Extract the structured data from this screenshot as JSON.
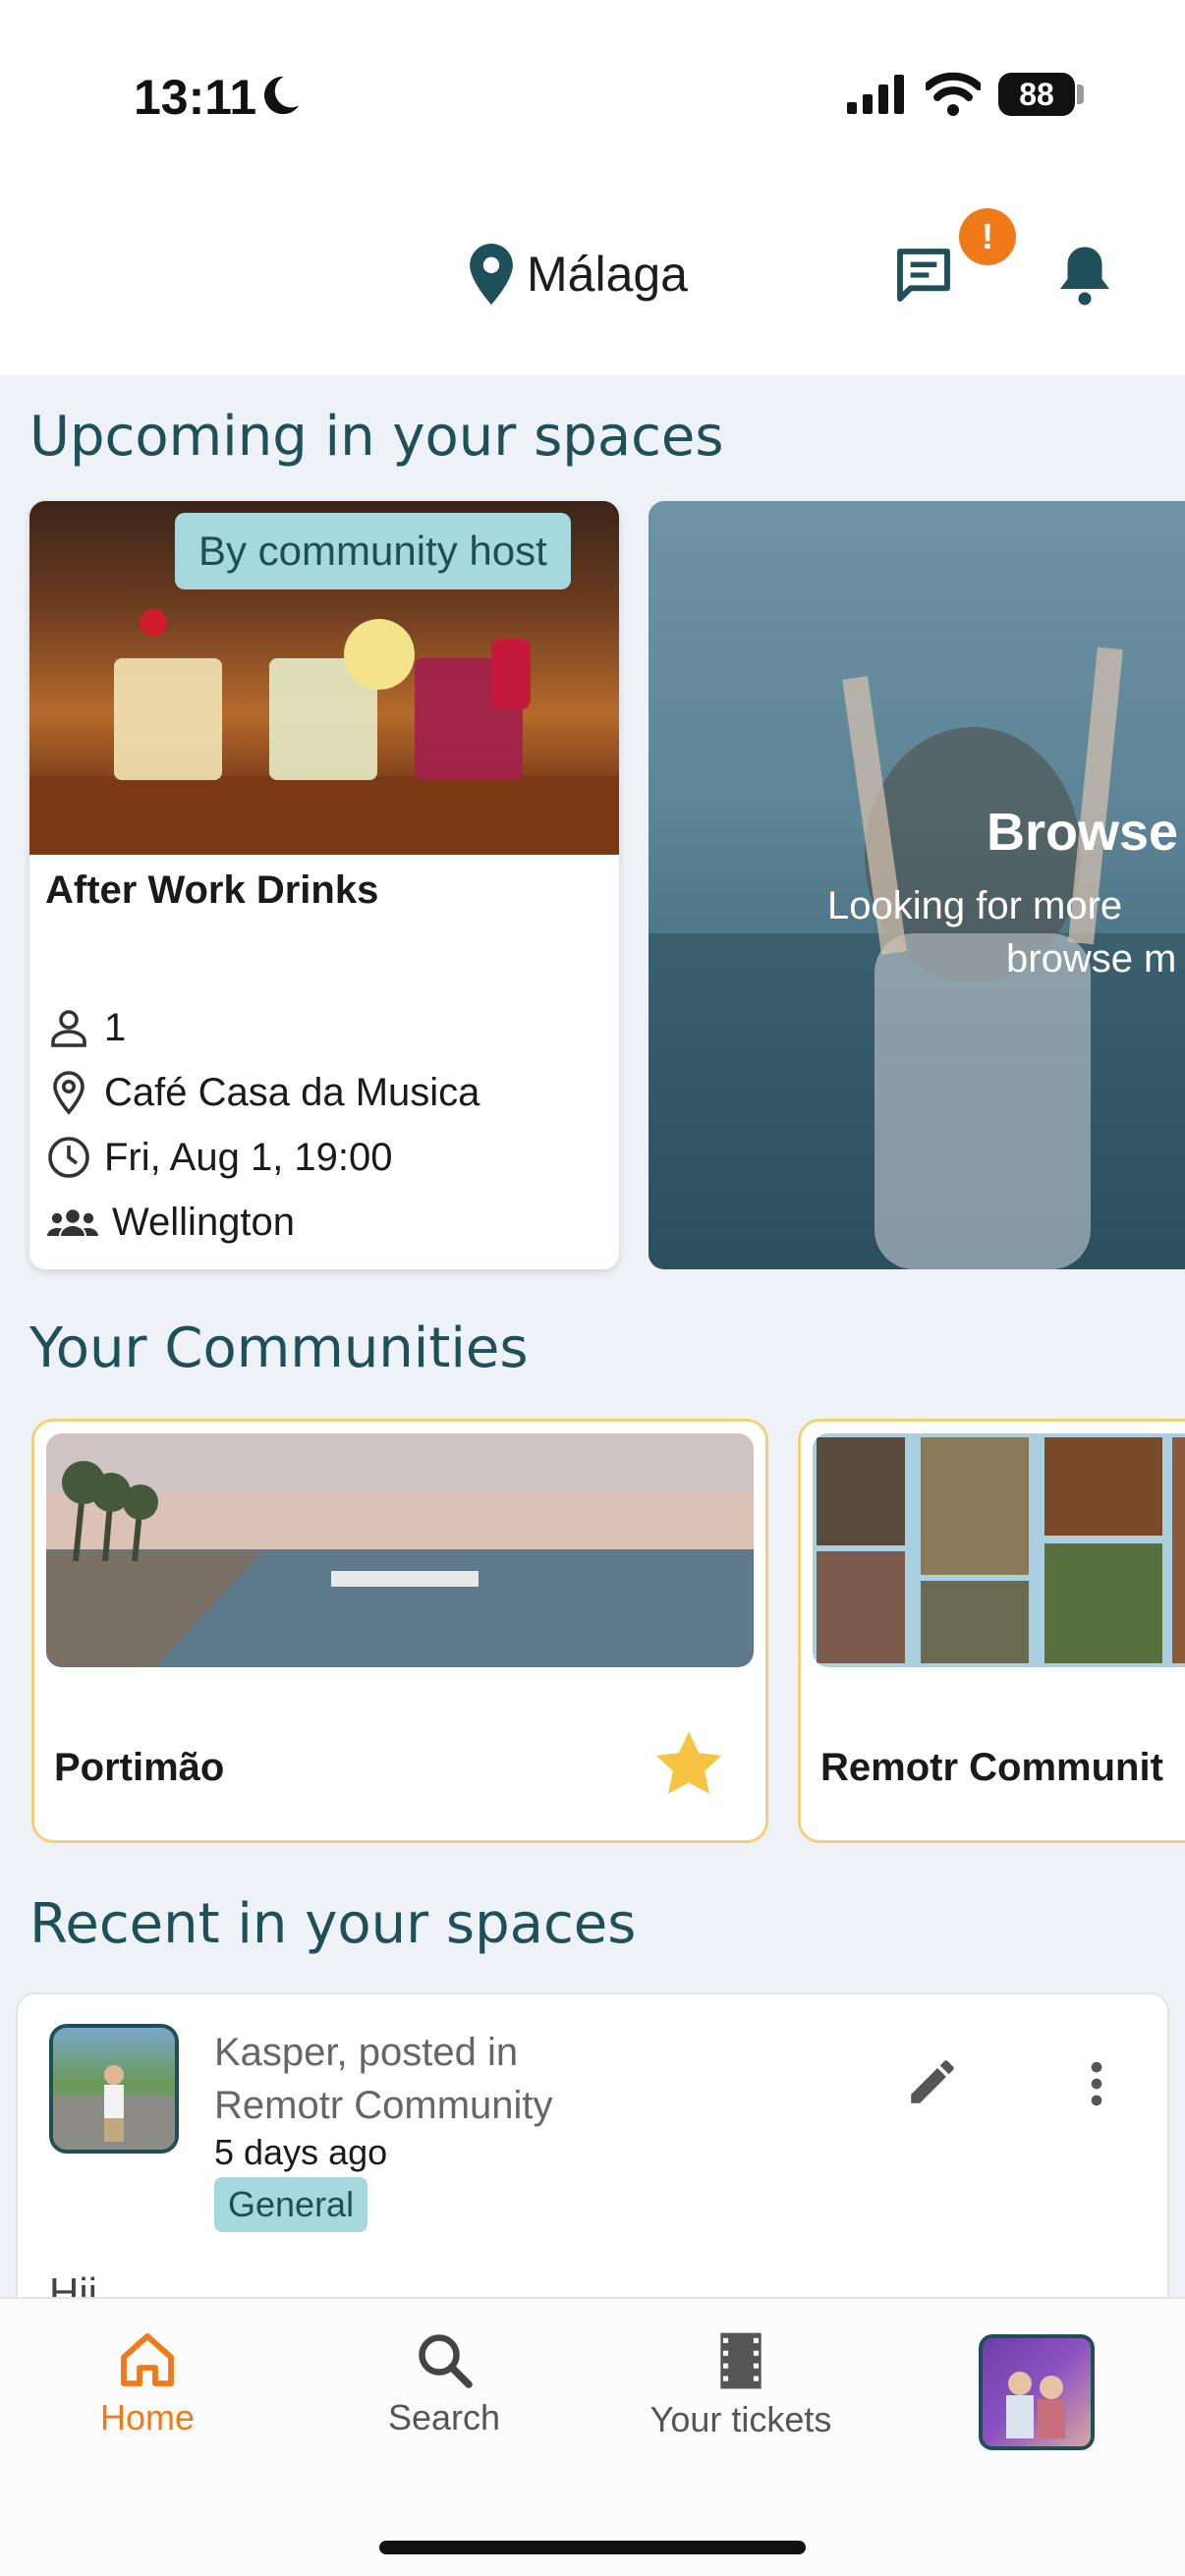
{
  "status": {
    "time": "13:11",
    "battery": "88"
  },
  "header": {
    "location": "Málaga",
    "chat_badge": "!"
  },
  "sections": {
    "upcoming": "Upcoming in your spaces",
    "communities": "Your Communities",
    "recent": "Recent in your spaces"
  },
  "event_card": {
    "tag": "By community host",
    "title": "After Work Drinks",
    "attendees": "1",
    "venue": "Café Casa da Musica",
    "datetime": "Fri, Aug 1, 19:00",
    "community": "Wellington"
  },
  "browse_card": {
    "title": "Browse",
    "line1": "Looking for more",
    "line2": "browse m"
  },
  "communities": [
    {
      "name": "Portimão",
      "favorite": true
    },
    {
      "name": "Remotr Communit",
      "favorite": false
    }
  ],
  "post": {
    "author_line1": "Kasper, posted in",
    "author_line2": "Remotr Community",
    "time": "5 days ago",
    "tag": "General",
    "body": "Hii"
  },
  "nav": {
    "home": "Home",
    "search": "Search",
    "tickets": "Your tickets"
  },
  "colors": {
    "primary": "#1d5058",
    "accent": "#f07a17",
    "tag_bg": "#a6d9de",
    "community_border": "#f1d17a",
    "background": "#eef2f7"
  }
}
